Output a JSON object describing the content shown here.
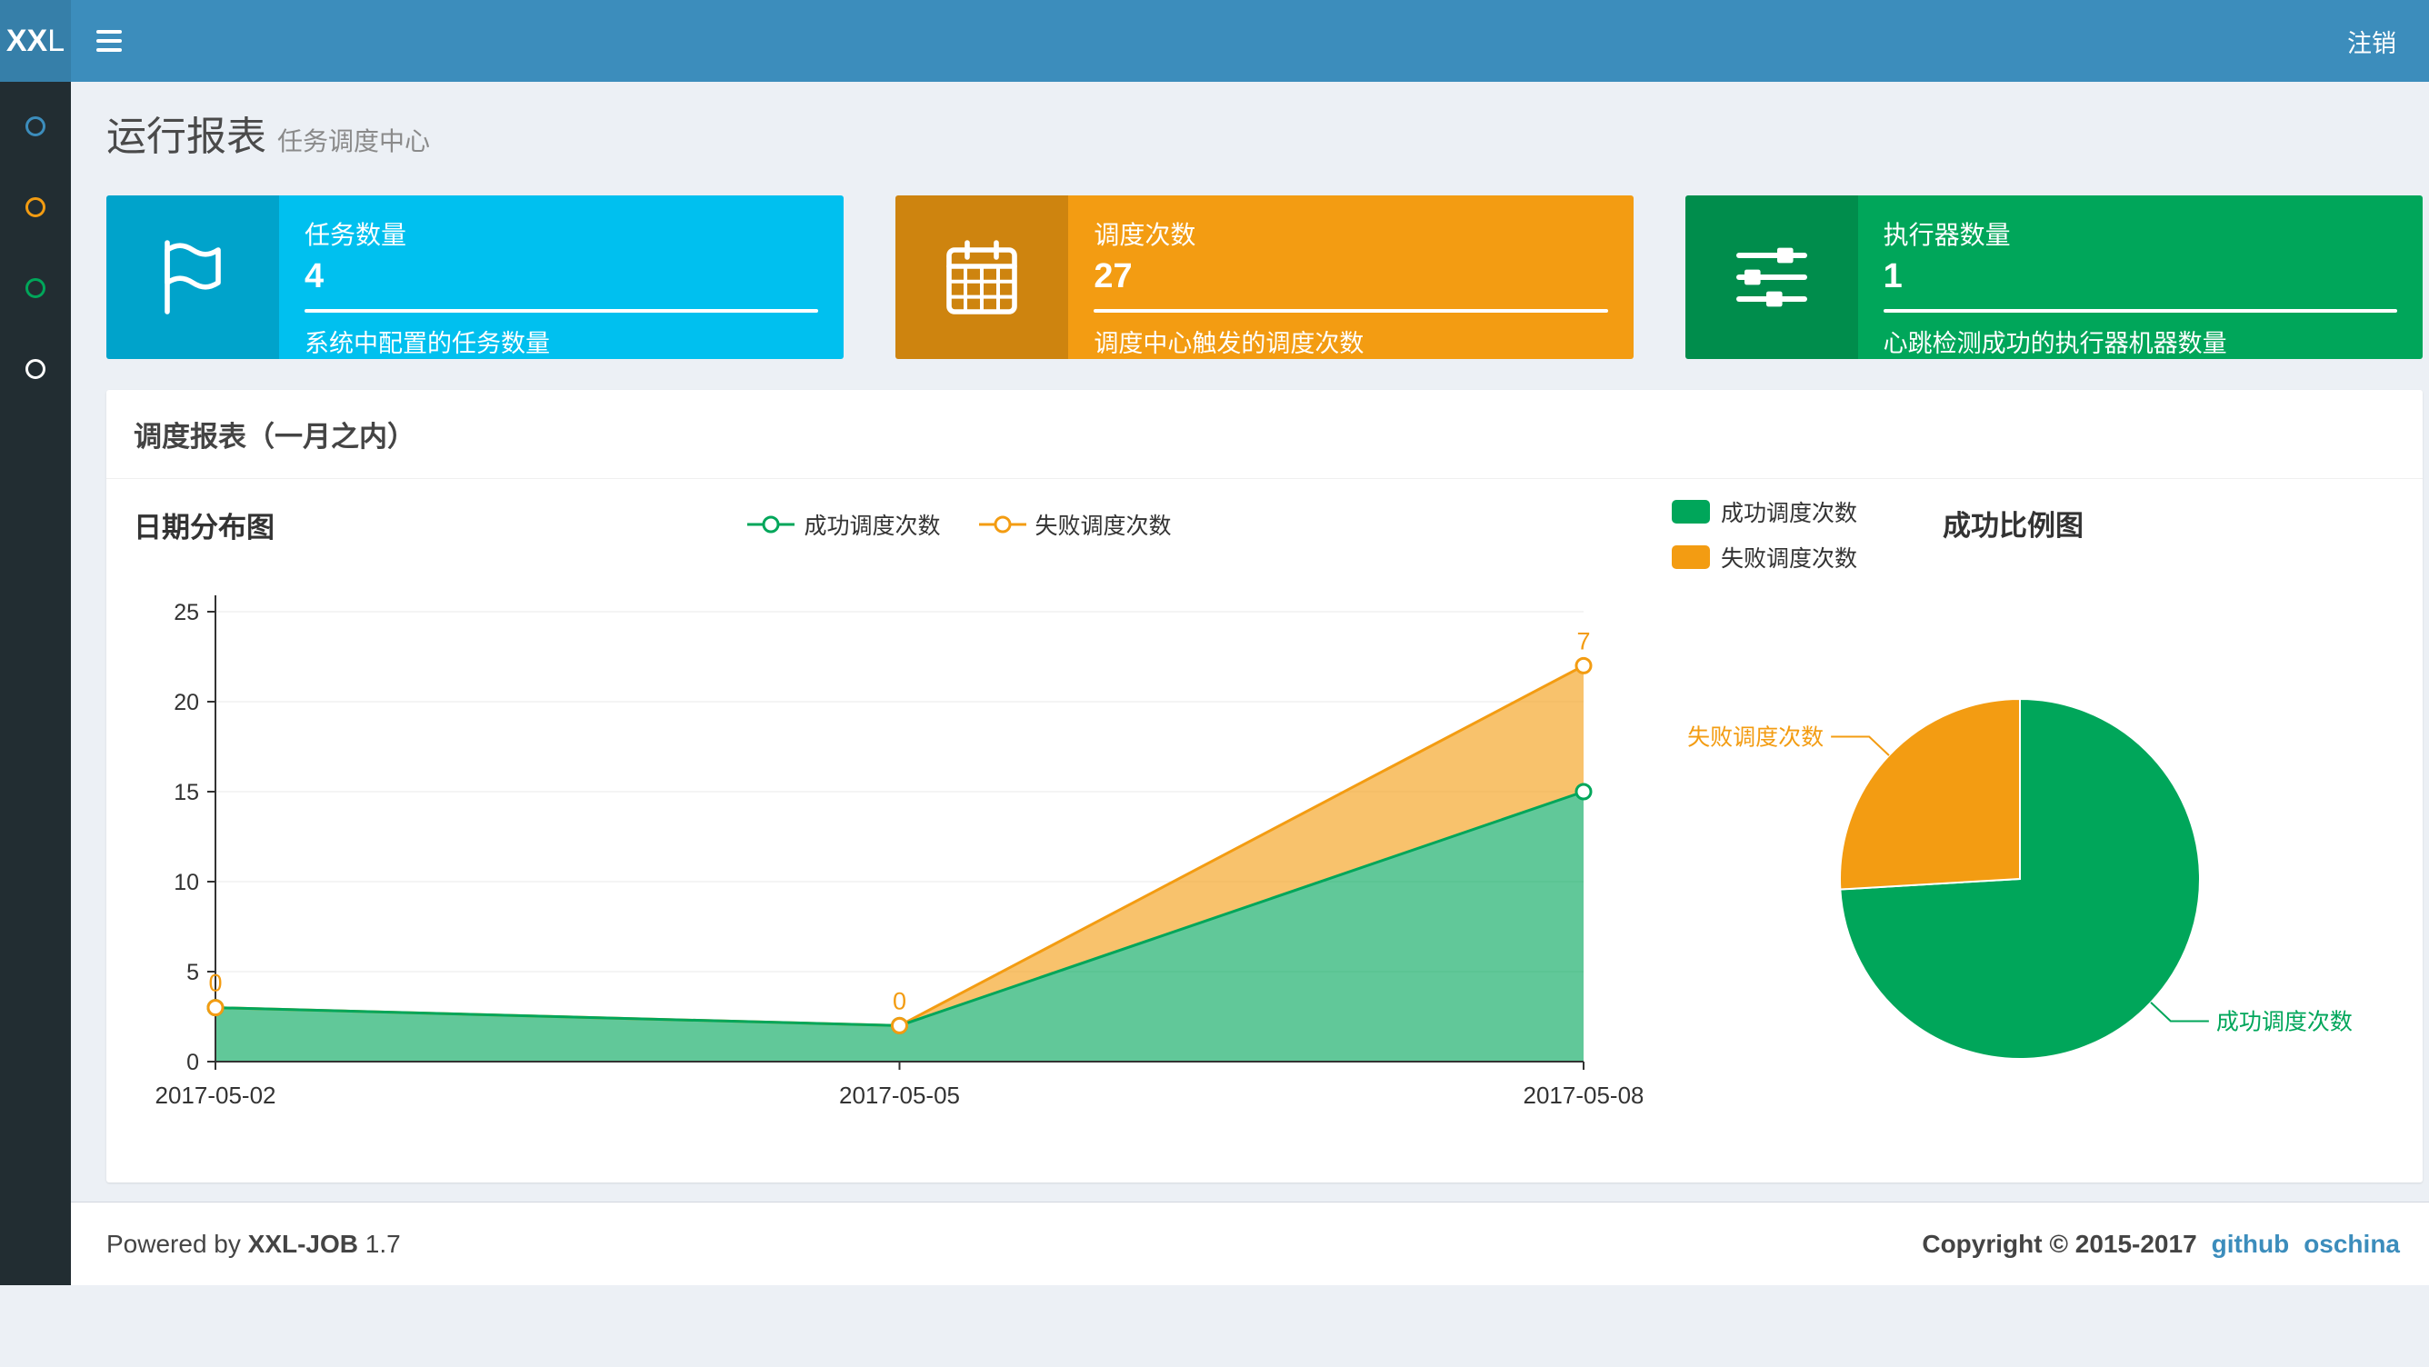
{
  "navbar": {
    "logo_bold": "XX",
    "logo_light": "L",
    "logout_label": "注销"
  },
  "sidebar": {
    "item_colors": [
      "#3c8dbc",
      "#f39c12",
      "#00a65a",
      "#ffffff"
    ]
  },
  "page_header": {
    "title": "运行报表",
    "subtitle": "任务调度中心"
  },
  "info_boxes": [
    {
      "label": "任务数量",
      "value": "4",
      "description": "系统中配置的任务数量",
      "bg": "#00c0ef",
      "icon": "flag-icon"
    },
    {
      "label": "调度次数",
      "value": "27",
      "description": "调度中心触发的调度次数",
      "bg": "#f39c12",
      "icon": "calendar-icon"
    },
    {
      "label": "执行器数量",
      "value": "1",
      "description": "心跳检测成功的执行器机器数量",
      "bg": "#00a65a",
      "icon": "sliders-icon"
    }
  ],
  "panel": {
    "title": "调度报表（一月之内）"
  },
  "chart_data": [
    {
      "type": "area",
      "title": "日期分布图",
      "x": [
        "2017-05-02",
        "2017-05-05",
        "2017-05-08"
      ],
      "stacked": true,
      "ylim": [
        0,
        25
      ],
      "yticks": [
        0,
        5,
        10,
        15,
        20,
        25
      ],
      "legend_position": "top",
      "series": [
        {
          "name": "成功调度次数",
          "color": "#00a65a",
          "values": [
            3,
            2,
            15
          ]
        },
        {
          "name": "失败调度次数",
          "color": "#f39c12",
          "values": [
            0,
            0,
            7
          ],
          "point_labels": [
            "0",
            "0",
            "7"
          ]
        }
      ]
    },
    {
      "type": "pie",
      "title": "成功比例图",
      "legend_position": "top-left",
      "slices": [
        {
          "name": "成功调度次数",
          "value": 20,
          "color": "#00a65a"
        },
        {
          "name": "失败调度次数",
          "value": 7,
          "color": "#f39c12"
        }
      ]
    }
  ],
  "footer": {
    "powered_prefix": "Powered by",
    "brand": "XXL-JOB",
    "version": "1.7",
    "copyright": "Copyright © 2015-2017",
    "links": [
      "github",
      "oschina"
    ]
  }
}
